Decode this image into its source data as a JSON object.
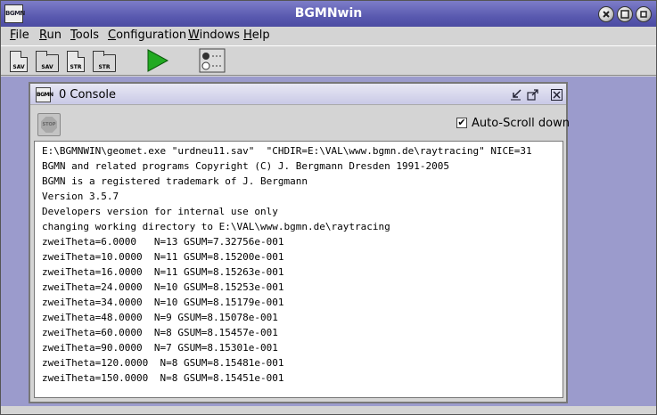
{
  "window": {
    "title": "BGMNwin",
    "icon_text": "BGMN"
  },
  "menu": [
    {
      "label": "File",
      "u": "F",
      "rest": "ile"
    },
    {
      "label": "Run",
      "u": "R",
      "rest": "un"
    },
    {
      "label": "Tools",
      "u": "T",
      "rest": "ools"
    },
    {
      "label": "Configuration",
      "u": "C",
      "rest": "onfiguration"
    },
    {
      "label": "Windows",
      "u": "W",
      "rest": "indows"
    },
    {
      "label": "Help",
      "u": "H",
      "rest": "elp"
    }
  ],
  "toolbar": {
    "save_doc": "SAV",
    "save_folder": "SAV",
    "str_doc": "STR",
    "str_folder": "STR"
  },
  "console_window": {
    "title": "0 Console",
    "icon_text": "BGMN",
    "stop_text": "STOP",
    "autoscroll_label": "Auto-Scroll down",
    "autoscroll_checked": true,
    "lines": [
      "E:\\BGMNWIN\\geomet.exe \"urdneu11.sav\"  \"CHDIR=E:\\VAL\\www.bgmn.de\\raytracing\" NICE=31",
      "BGMN and related programs Copyright (C) J. Bergmann Dresden 1991-2005",
      "BGMN is a registered trademark of J. Bergmann",
      "Version 3.5.7",
      "Developers version for internal use only",
      "changing working directory to E:\\VAL\\www.bgmn.de\\raytracing",
      "zweiTheta=6.0000   N=13 GSUM=7.32756e-001",
      "zweiTheta=10.0000  N=11 GSUM=8.15200e-001",
      "zweiTheta=16.0000  N=11 GSUM=8.15263e-001",
      "zweiTheta=24.0000  N=10 GSUM=8.15253e-001",
      "zweiTheta=34.0000  N=10 GSUM=8.15179e-001",
      "zweiTheta=48.0000  N=9 GSUM=8.15078e-001",
      "zweiTheta=60.0000  N=8 GSUM=8.15457e-001",
      "zweiTheta=90.0000  N=7 GSUM=8.15301e-001",
      "zweiTheta=120.0000  N=8 GSUM=8.15481e-001",
      "zweiTheta=150.0000  N=8 GSUM=8.15451e-001"
    ]
  },
  "colors": {
    "titlebar": "#5a5ab0",
    "desktop": "#9b9bcc",
    "run_arrow": "#22aa22"
  }
}
